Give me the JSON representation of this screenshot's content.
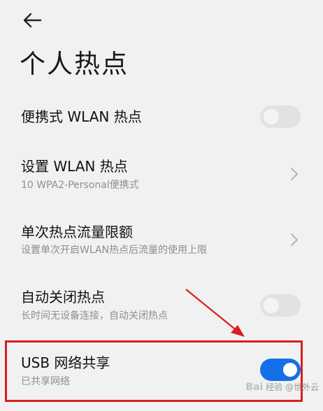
{
  "header": {
    "title": "个人热点"
  },
  "settings": {
    "portable_hotspot": {
      "label": "便携式 WLAN 热点",
      "enabled": false
    },
    "configure_hotspot": {
      "label": "设置 WLAN 热点",
      "subtitle": "10 WPA2-Personal便携式"
    },
    "data_limit": {
      "label": "单次热点流量限额",
      "subtitle": "设置单次开启WLAN热点后流量的使用上限"
    },
    "auto_off": {
      "label": "自动关闭热点",
      "subtitle": "长时间无设备连接，自动关闭热点",
      "enabled": false
    },
    "usb_tethering": {
      "label": "USB 网络共享",
      "subtitle": "已共享网络",
      "enabled": true
    }
  },
  "watermark": {
    "logo": "Bai",
    "text": "经验 @世外云"
  },
  "colors": {
    "background": "#f1f1f1",
    "toggle_on": "#1570e8",
    "toggle_off": "#e2e2e2",
    "annotation": "#d81e1e"
  },
  "icons": {
    "back": "arrow-left-icon",
    "chevron": "chevron-right-icon"
  }
}
